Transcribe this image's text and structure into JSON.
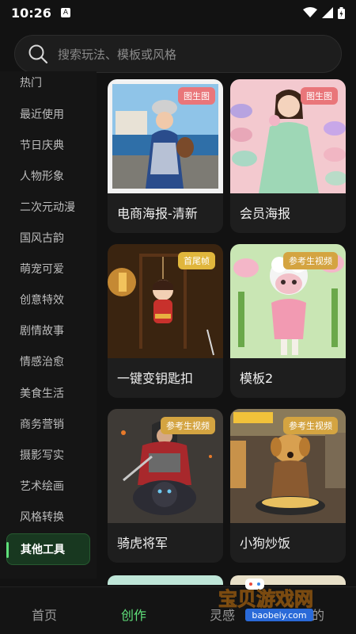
{
  "status_bar": {
    "time": "10:26",
    "notification_icon": "A"
  },
  "search": {
    "placeholder": "搜索玩法、模板或风格"
  },
  "sidebar": {
    "items": [
      {
        "label": "热门"
      },
      {
        "label": "最近使用"
      },
      {
        "label": "节日庆典"
      },
      {
        "label": "人物形象"
      },
      {
        "label": "二次元动漫"
      },
      {
        "label": "国风古韵"
      },
      {
        "label": "萌宠可爱"
      },
      {
        "label": "创意特效"
      },
      {
        "label": "剧情故事"
      },
      {
        "label": "情感治愈"
      },
      {
        "label": "美食生活"
      },
      {
        "label": "商务营销"
      },
      {
        "label": "摄影写实"
      },
      {
        "label": "艺术绘画"
      },
      {
        "label": "风格转换"
      }
    ],
    "active_label": "其他工具",
    "accent": "#5fe07a"
  },
  "cards": [
    {
      "title": "电商海报-清新",
      "badge": "图生图",
      "badge_color": "#e9767a"
    },
    {
      "title": "会员海报",
      "badge": "图生图",
      "badge_color": "#e9767a"
    },
    {
      "title": "一键变钥匙扣",
      "badge": "首尾帧",
      "badge_color": "#e0b63c"
    },
    {
      "title": "模板2",
      "badge": "参考生视频",
      "badge_color": "#d4a441"
    },
    {
      "title": "骑虎将军",
      "badge": "参考生视频",
      "badge_color": "#d4a441"
    },
    {
      "title": "小狗炒饭",
      "badge": "参考生视频",
      "badge_color": "#d4a441"
    }
  ],
  "bottom_nav": {
    "items": [
      {
        "label": "首页"
      },
      {
        "label": "创作"
      },
      {
        "label": "灵感"
      },
      {
        "label": "我的"
      }
    ],
    "active": "创作"
  },
  "watermark": {
    "text": "宝贝游戏网",
    "url": "baobeiy.com"
  }
}
